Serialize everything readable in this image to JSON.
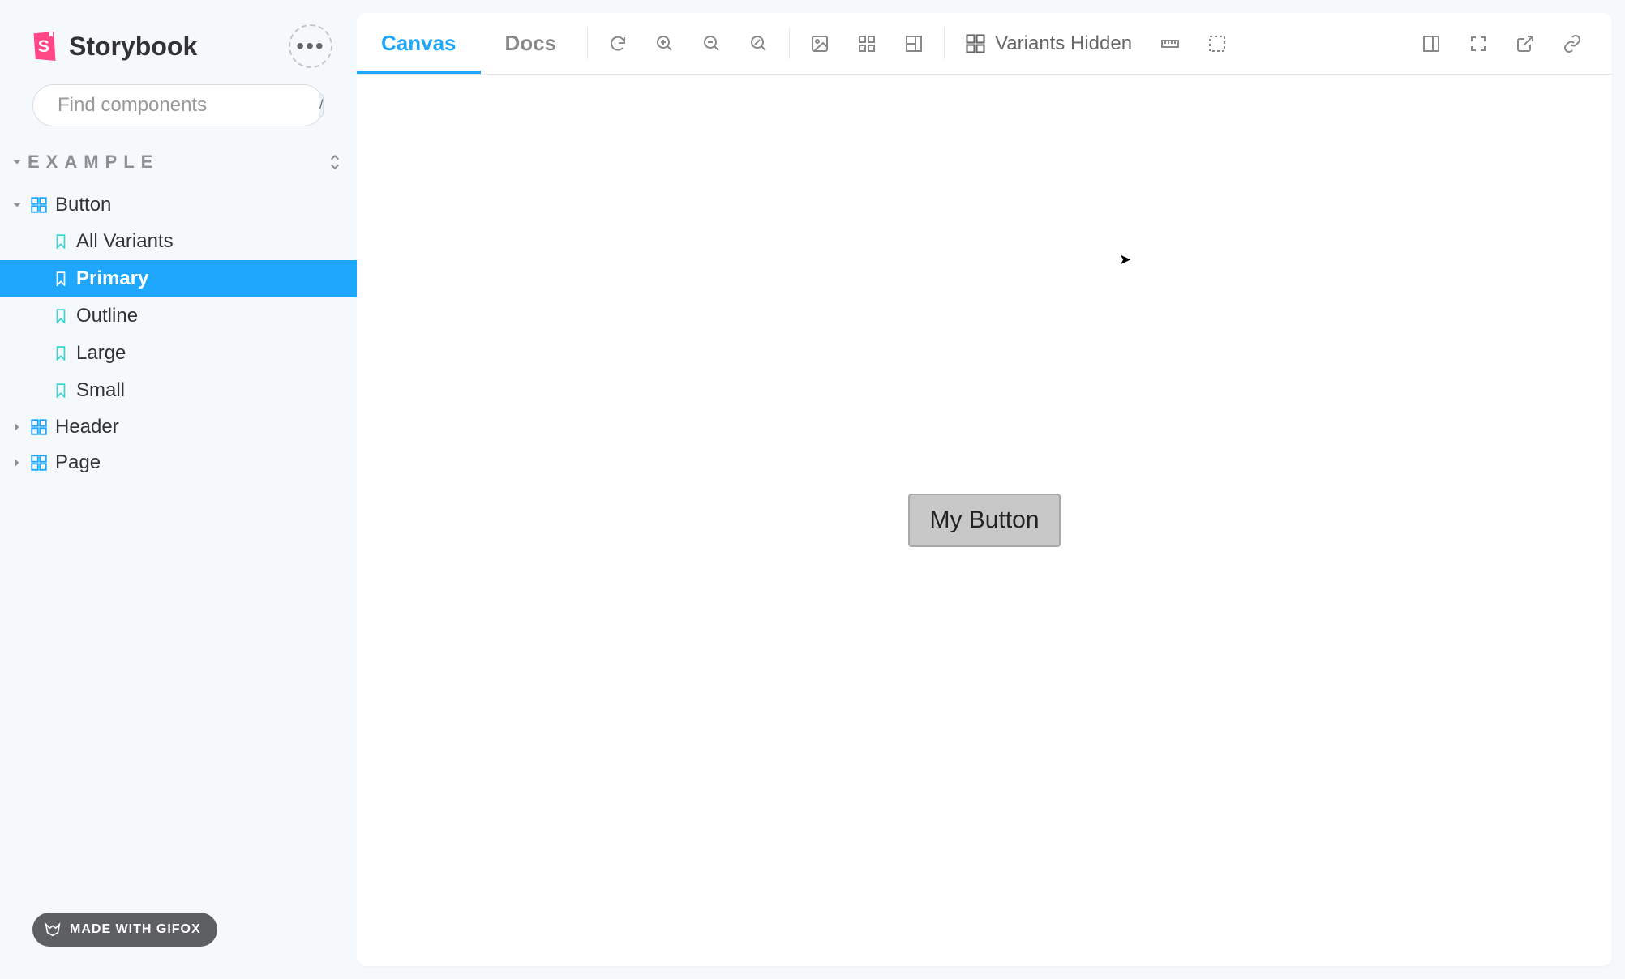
{
  "brand": {
    "name": "Storybook"
  },
  "search": {
    "placeholder": "Find components",
    "key": "/"
  },
  "section": {
    "title": "EXAMPLE"
  },
  "tree": {
    "button": {
      "label": "Button"
    },
    "stories": {
      "all_variants": "All Variants",
      "primary": "Primary",
      "outline": "Outline",
      "large": "Large",
      "small": "Small"
    },
    "header": {
      "label": "Header"
    },
    "page": {
      "label": "Page"
    }
  },
  "gifox": {
    "label": "MADE WITH GIFOX"
  },
  "tabs": {
    "canvas": "Canvas",
    "docs": "Docs"
  },
  "toolbar": {
    "variants": "Variants Hidden"
  },
  "preview": {
    "button_label": "My Button"
  }
}
